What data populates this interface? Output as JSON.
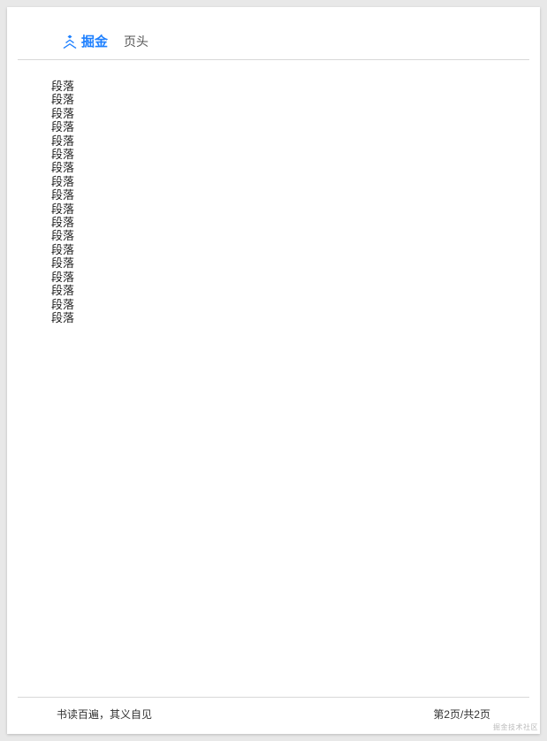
{
  "header": {
    "logo_text": "掘金",
    "title": "页头"
  },
  "paragraphs": [
    "段落",
    "段落",
    "段落",
    "段落",
    "段落",
    "段落",
    "段落",
    "段落",
    "段落",
    "段落",
    "段落",
    "段落",
    "段落",
    "段落",
    "段落",
    "段落",
    "段落",
    "段落"
  ],
  "footer": {
    "left_text": "书读百遍，其义自见",
    "right_text": "第2页/共2页"
  },
  "watermark": "掘金技术社区",
  "colors": {
    "brand": "#1e80ff"
  }
}
